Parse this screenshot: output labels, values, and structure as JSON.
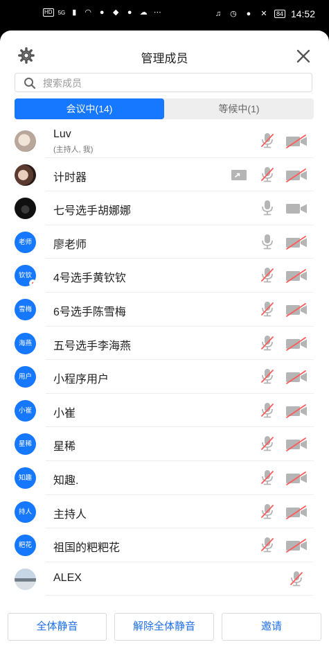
{
  "status_bar": {
    "hd": "HD",
    "signal": "5G",
    "battery": "84",
    "time": "14:52"
  },
  "header": {
    "title": "管理成员"
  },
  "search": {
    "placeholder": "搜索成员"
  },
  "tabs": [
    {
      "label": "会议中(14)",
      "active": true
    },
    {
      "label": "等候中(1)",
      "active": false
    }
  ],
  "members": [
    {
      "name": "Luv",
      "sub": "(主持人, 我)",
      "avatar": "photo",
      "avatar_text": "",
      "mic_muted": true,
      "camera_off": true,
      "sharing": false
    },
    {
      "name": "计时器",
      "sub": "",
      "avatar": "photo",
      "avatar_text": "",
      "mic_muted": true,
      "camera_off": true,
      "sharing": true
    },
    {
      "name": "七号选手胡娜娜",
      "sub": "",
      "avatar": "photo",
      "avatar_text": "",
      "mic_muted": false,
      "camera_off": false,
      "sharing": false
    },
    {
      "name": "廖老师",
      "sub": "",
      "avatar": "text",
      "avatar_text": "老师",
      "mic_muted": false,
      "camera_off": true,
      "sharing": false
    },
    {
      "name": "4号选手黄钦钦",
      "sub": "",
      "avatar": "text",
      "avatar_text": "钦钦",
      "mic_muted": true,
      "camera_off": true,
      "sharing": false
    },
    {
      "name": "6号选手陈雪梅",
      "sub": "",
      "avatar": "text",
      "avatar_text": "雪梅",
      "mic_muted": true,
      "camera_off": true,
      "sharing": false
    },
    {
      "name": "五号选手李海燕",
      "sub": "",
      "avatar": "text",
      "avatar_text": "海燕",
      "mic_muted": true,
      "camera_off": true,
      "sharing": false
    },
    {
      "name": "小程序用户",
      "sub": "",
      "avatar": "text",
      "avatar_text": "用户",
      "mic_muted": true,
      "camera_off": true,
      "sharing": false
    },
    {
      "name": "小崔",
      "sub": "",
      "avatar": "text",
      "avatar_text": "小崔",
      "mic_muted": true,
      "camera_off": true,
      "sharing": false
    },
    {
      "name": "星稀",
      "sub": "",
      "avatar": "text",
      "avatar_text": "星稀",
      "mic_muted": true,
      "camera_off": true,
      "sharing": false
    },
    {
      "name": "知趣.",
      "sub": "",
      "avatar": "text",
      "avatar_text": "知趣",
      "mic_muted": true,
      "camera_off": true,
      "sharing": false
    },
    {
      "name": "主持人",
      "sub": "",
      "avatar": "text",
      "avatar_text": "持人",
      "mic_muted": true,
      "camera_off": true,
      "sharing": false
    },
    {
      "name": "祖国的粑粑花",
      "sub": "",
      "avatar": "text",
      "avatar_text": "粑花",
      "mic_muted": true,
      "camera_off": true,
      "sharing": false
    },
    {
      "name": "ALEX",
      "sub": "",
      "avatar": "photo",
      "avatar_text": "",
      "mic_muted": true,
      "camera_off": null,
      "sharing": false
    }
  ],
  "footer": {
    "mute_all": "全体静音",
    "unmute_all": "解除全体静音",
    "invite": "邀请"
  },
  "colors": {
    "accent": "#1677ff",
    "muted_red": "#ff5a5a",
    "icon_gray": "#b5b5b5"
  }
}
